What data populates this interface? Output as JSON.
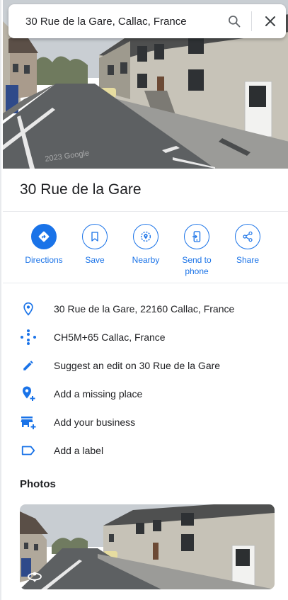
{
  "search": {
    "value": "30 Rue de la Gare, Callac, France"
  },
  "place": {
    "title": "30 Rue de la Gare"
  },
  "street_view_watermark": "2023 Google",
  "actions": [
    {
      "label": "Directions",
      "icon": "directions-icon"
    },
    {
      "label": "Save",
      "icon": "bookmark-icon"
    },
    {
      "label": "Nearby",
      "icon": "nearby-icon"
    },
    {
      "label": "Send to phone",
      "icon": "send-to-phone-icon"
    },
    {
      "label": "Share",
      "icon": "share-icon"
    }
  ],
  "info": [
    {
      "text": "30 Rue de la Gare, 22160 Callac, France",
      "icon": "location-pin-icon"
    },
    {
      "text": "CH5M+65 Callac, France",
      "icon": "plus-code-icon"
    },
    {
      "text": "Suggest an edit on 30 Rue de la Gare",
      "icon": "pencil-icon"
    },
    {
      "text": "Add a missing place",
      "icon": "add-place-icon"
    },
    {
      "text": "Add your business",
      "icon": "add-business-icon"
    },
    {
      "text": "Add a label",
      "icon": "label-icon"
    }
  ],
  "photos": {
    "heading": "Photos"
  },
  "colors": {
    "accent": "#1a73e8",
    "text": "#202124",
    "divider": "#e8eaed"
  }
}
